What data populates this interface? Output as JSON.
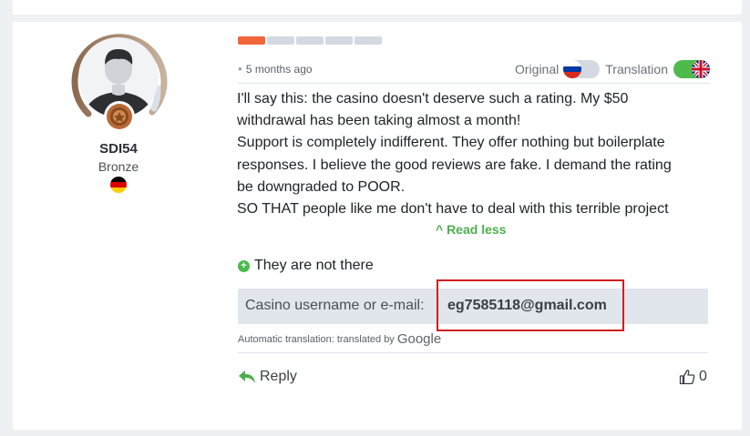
{
  "review": {
    "user": {
      "name": "SDI54",
      "rank": "Bronze",
      "country_flag": "germany-flag-icon",
      "avatar_icon": "default-avatar-icon",
      "badge_icon": "bronze-badge-icon"
    },
    "rating": {
      "filled": 1,
      "total": 5,
      "filled_color": "#f2653a"
    },
    "time": "5 months ago",
    "language": {
      "original_label": "Original",
      "original_flag": "russia-flag-icon",
      "translation_label": "Translation",
      "translation_flag": "uk-flag-icon",
      "translation_on": true,
      "toggle_on_color": "#4cbb4c"
    },
    "text_lines": [
      "I'll say this: the casino doesn't deserve such a rating. My $50",
      "withdrawal has been taking almost a month!",
      "Support is completely indifferent. They offer nothing but boilerplate",
      "responses. I believe the good reviews are fake. I demand the rating",
      "be downgraded to POOR.",
      "SO THAT people like me don't have to deal with this terrible project"
    ],
    "read_less": "^ Read less",
    "status": "They are not there",
    "casino_username_label": "Casino username or e-mail:",
    "casino_username_value": "eg7585118@gmail.com",
    "auto_translation": "Automatic translation: translated by",
    "google_brand": "Google",
    "reply_label": "Reply",
    "likes": "0"
  }
}
